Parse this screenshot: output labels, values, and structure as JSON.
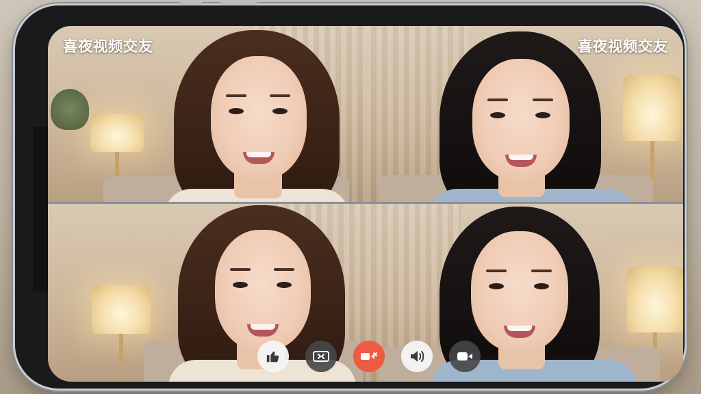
{
  "app": {
    "watermark_left": "喜夜视频交友",
    "watermark_right": "喜夜视频交友"
  },
  "participants": [
    {
      "position": "top-left",
      "hair": "brown"
    },
    {
      "position": "top-right",
      "hair": "black"
    },
    {
      "position": "bottom-left",
      "hair": "brown"
    },
    {
      "position": "bottom-right",
      "hair": "black"
    }
  ],
  "controls": [
    {
      "name": "like",
      "icon": "thumbs-up-icon",
      "style": "light"
    },
    {
      "name": "switch-camera",
      "icon": "switch-camera-icon",
      "style": "dark"
    },
    {
      "name": "end-call",
      "icon": "video-call-end-icon",
      "style": "red"
    },
    {
      "name": "speaker",
      "icon": "speaker-icon",
      "style": "light"
    },
    {
      "name": "camera-toggle",
      "icon": "video-camera-icon",
      "style": "dark"
    }
  ],
  "colors": {
    "end_call": "#ee5a44",
    "watermark_text": "#ffffff"
  }
}
